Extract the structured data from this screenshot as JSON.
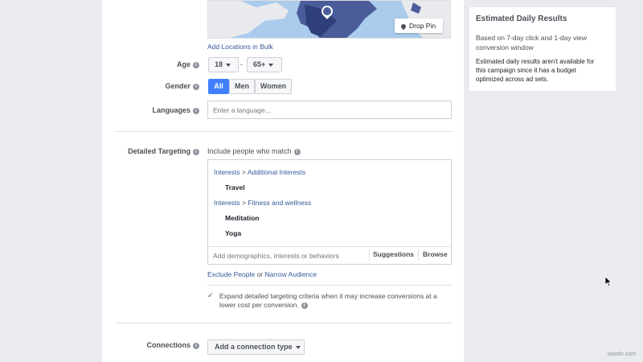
{
  "map": {
    "drop_pin_label": "Drop Pin",
    "add_bulk_label": "Add Locations in Bulk"
  },
  "age": {
    "label": "Age",
    "min": "18",
    "separator": "-",
    "max": "65+"
  },
  "gender": {
    "label": "Gender",
    "options": [
      "All",
      "Men",
      "Women"
    ],
    "selected": "All"
  },
  "languages": {
    "label": "Languages",
    "placeholder": "Enter a language..."
  },
  "detailed_targeting": {
    "label": "Detailed Targeting",
    "include_label": "Include people who match",
    "groups": [
      {
        "path_root": "Interests",
        "path_sep": ">",
        "path_leaf": "Additional Interests",
        "items": [
          "Travel"
        ]
      },
      {
        "path_root": "Interests",
        "path_sep": ">",
        "path_leaf": "Fitness and wellness",
        "items": [
          "Meditation",
          "Yoga"
        ]
      }
    ],
    "search_placeholder": "Add demographics, interests or behaviors",
    "suggestions_label": "Suggestions",
    "browse_label": "Browse",
    "exclude_link": "Exclude People",
    "or_text": "or",
    "narrow_link": "Narrow Audience",
    "expand_line1": "Expand detailed targeting criteria when it may increase conversions at a",
    "expand_line2": "lower cost per conversion.",
    "expand_checked": true
  },
  "connections": {
    "label": "Connections",
    "button_label": "Add a connection type"
  },
  "estimated": {
    "title": "Estimated Daily Results",
    "window_line1": "Based on 7-day click and 1-day view",
    "window_line2": "conversion window",
    "note_line1": "Estimated daily results aren't available for",
    "note_line2": "this campaign since it has a budget",
    "note_line3": "optimized across ad sets."
  },
  "watermark": "wsxdn.com",
  "colors": {
    "accent": "#4080ff",
    "link": "#365899",
    "map_water": "#aacbec",
    "map_land": "#4a5d9a"
  }
}
